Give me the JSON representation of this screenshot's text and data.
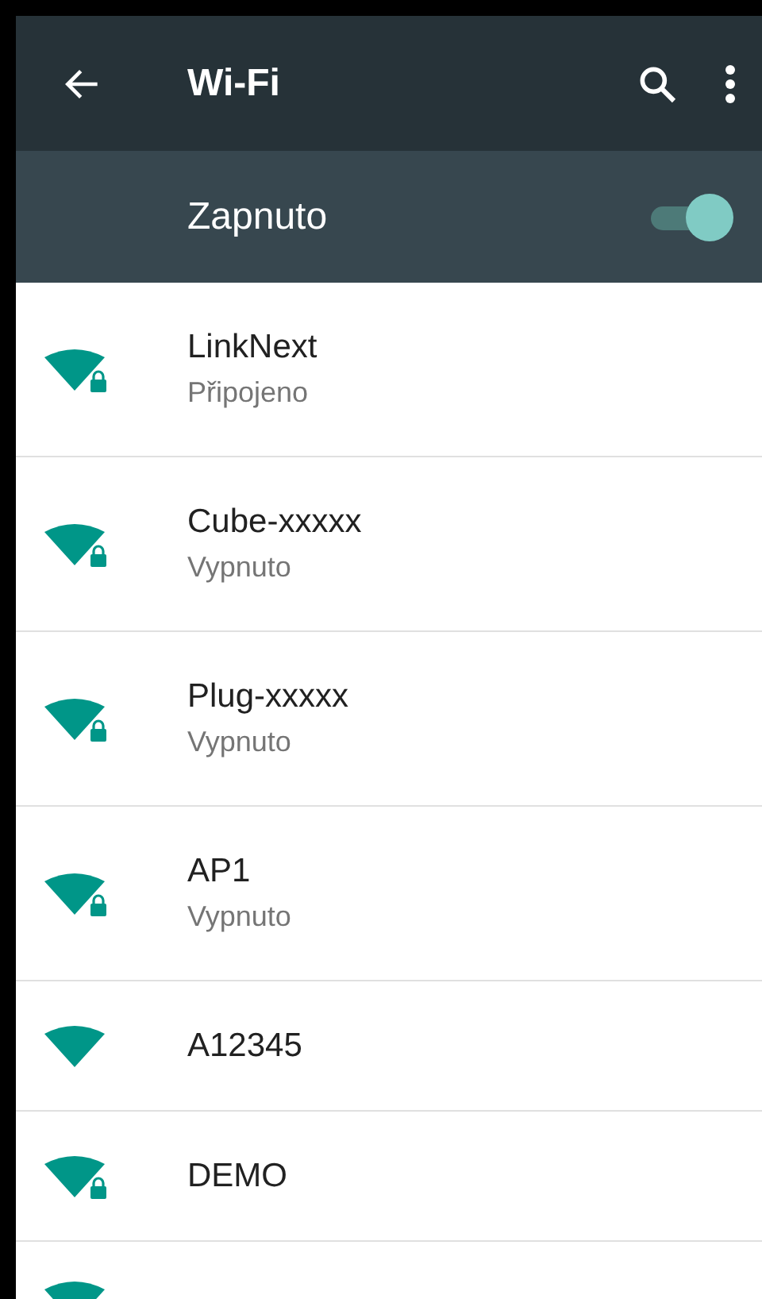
{
  "toolbar": {
    "title": "Wi-Fi"
  },
  "master_switch": {
    "label": "Zapnuto",
    "on": true
  },
  "networks": [
    {
      "name": "LinkNext",
      "status": "Připojeno",
      "secured": true
    },
    {
      "name": "Cube-xxxxx",
      "status": "Vypnuto",
      "secured": true
    },
    {
      "name": "Plug-xxxxx",
      "status": "Vypnuto",
      "secured": true
    },
    {
      "name": "AP1",
      "status": "Vypnuto",
      "secured": true
    },
    {
      "name": "A12345",
      "secured": false
    },
    {
      "name": "DEMO",
      "secured": true
    }
  ],
  "more_below": true
}
